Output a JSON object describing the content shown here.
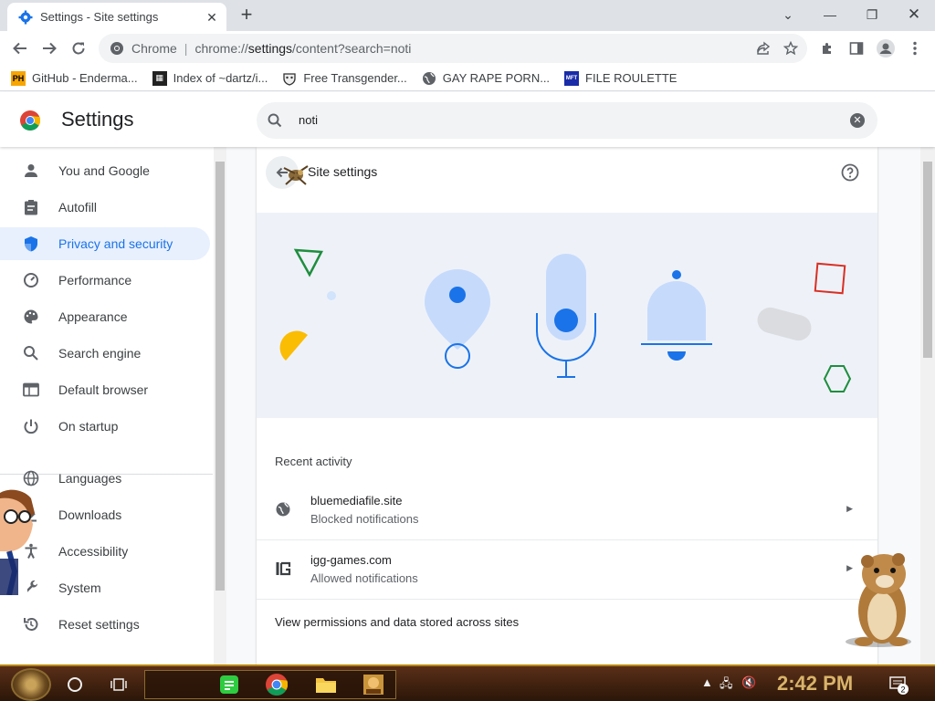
{
  "tab": {
    "title": "Settings - Site settings",
    "favicon": "gear-icon"
  },
  "omnibox": {
    "scheme_label": "Chrome",
    "url_prefix": "chrome://",
    "url_host": "settings",
    "url_path": "/content?search=noti"
  },
  "bookmarks": [
    {
      "label": "GitHub - Enderma...",
      "icon": "PH"
    },
    {
      "label": "Index of ~dartz/i...",
      "icon": "grid-icon"
    },
    {
      "label": "Free Transgender...",
      "icon": "mask-icon"
    },
    {
      "label": "GAY RAPE PORN...",
      "icon": "globe-icon"
    },
    {
      "label": "FILE ROULETTE",
      "icon": "MFT"
    }
  ],
  "settings": {
    "title": "Settings",
    "search_value": "noti"
  },
  "sidebar": {
    "items": [
      {
        "label": "You and Google",
        "icon": "person-icon",
        "active": false
      },
      {
        "label": "Autofill",
        "icon": "clipboard-icon",
        "active": false
      },
      {
        "label": "Privacy and security",
        "icon": "shield-icon",
        "active": true
      },
      {
        "label": "Performance",
        "icon": "speedometer-icon",
        "active": false
      },
      {
        "label": "Appearance",
        "icon": "palette-icon",
        "active": false
      },
      {
        "label": "Search engine",
        "icon": "search-icon",
        "active": false
      },
      {
        "label": "Default browser",
        "icon": "browser-icon",
        "active": false
      },
      {
        "label": "On startup",
        "icon": "power-icon",
        "active": false
      },
      {
        "label": "Languages",
        "icon": "globe-icon",
        "active": false
      },
      {
        "label": "Downloads",
        "icon": "download-icon",
        "active": false
      },
      {
        "label": "Accessibility",
        "icon": "accessibility-icon",
        "active": false
      },
      {
        "label": "System",
        "icon": "wrench-icon",
        "active": false
      },
      {
        "label": "Reset settings",
        "icon": "reset-icon",
        "active": false
      }
    ]
  },
  "main": {
    "page_title": "Site settings",
    "recent_label": "Recent activity",
    "recent": [
      {
        "site": "bluemediafile.site",
        "status": "Blocked notifications",
        "icon": "globe-icon"
      },
      {
        "site": "igg-games.com",
        "status": "Allowed notifications",
        "icon": "igg-icon"
      }
    ],
    "view_permissions": "View permissions and data stored across sites"
  },
  "taskbar": {
    "clock": "2:42 PM",
    "notification_count": "2"
  },
  "colors": {
    "accent": "#1a73e8",
    "active_bg": "#e8f0fe",
    "illustration_bg": "#eef2f8"
  }
}
